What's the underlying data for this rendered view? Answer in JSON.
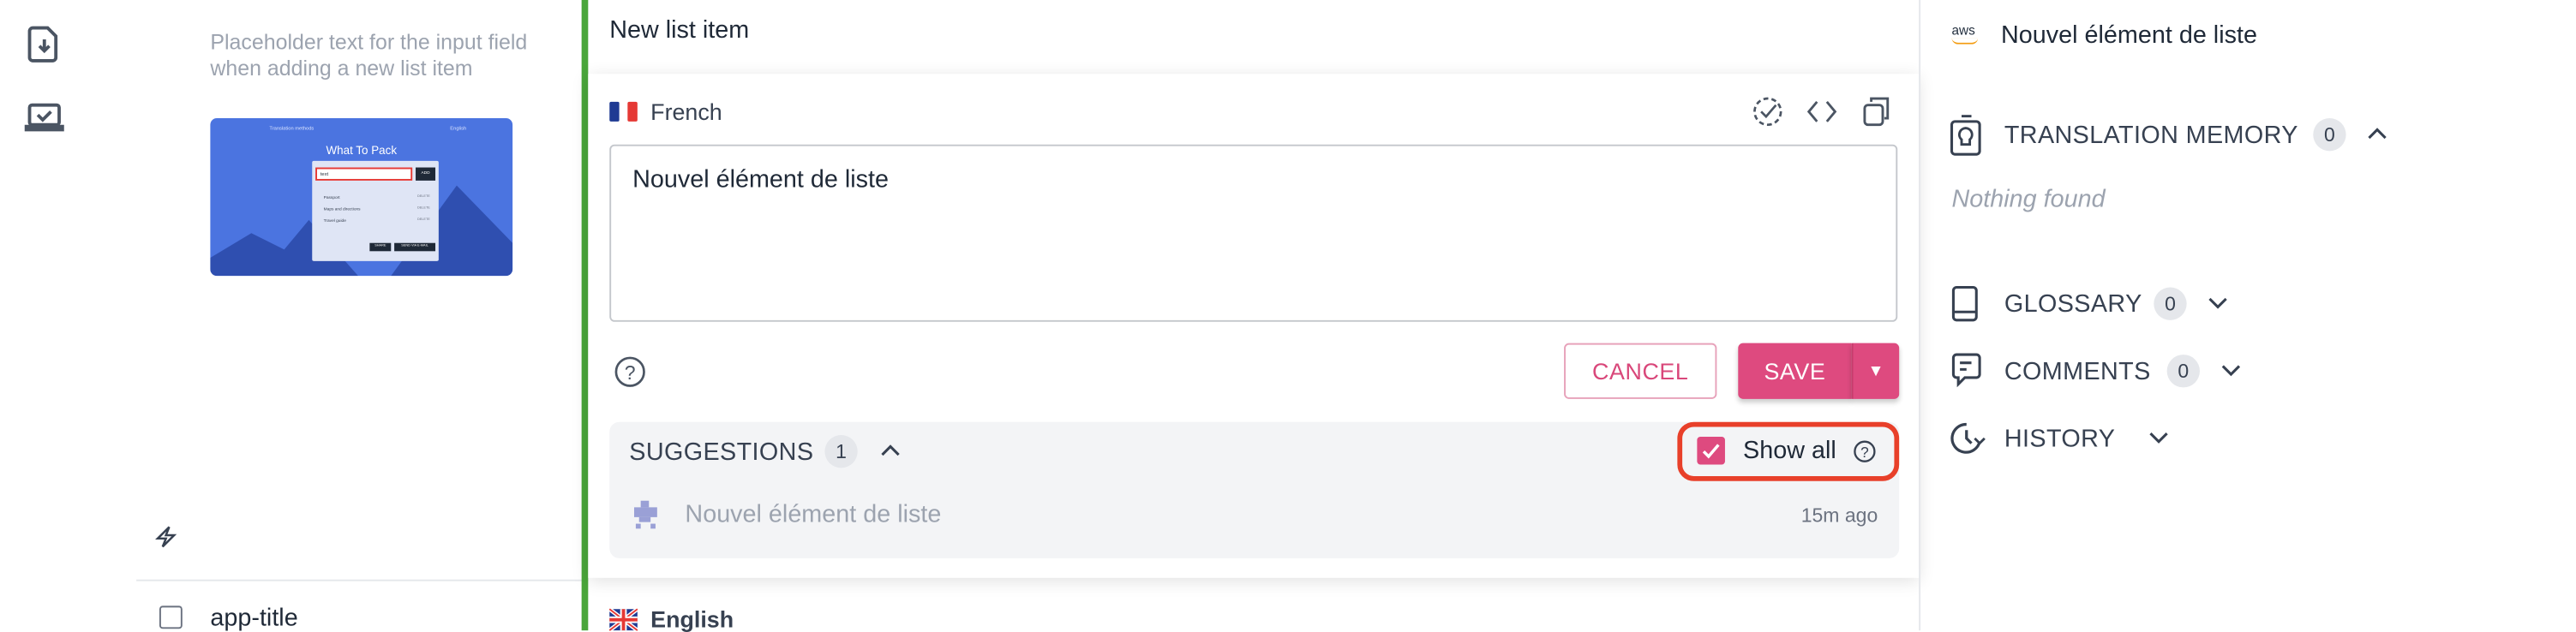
{
  "left": {
    "placeholder_text": "Placeholder text for the input field when adding a new list item",
    "screenshot": {
      "title": "What To Pack",
      "input_value": "text",
      "add_label": "ADD",
      "items": [
        "Passport",
        "Maps and directions",
        "Travel guide"
      ],
      "delete_label": "DELETE",
      "share_label": "SHARE",
      "email_label": "SEND VIA E-MAIL",
      "top_left": "Translation methods",
      "top_right": "English"
    },
    "next_key": "app-title"
  },
  "editor": {
    "source_text": "New list item",
    "language": "French",
    "translation_value": "Nouvel élément de liste",
    "cancel_label": "CANCEL",
    "save_label": "SAVE",
    "suggestions": {
      "title": "SUGGESTIONS",
      "count": "1",
      "show_all_label": "Show all",
      "show_all_checked": true,
      "items": [
        {
          "text": "Nouvel élément de liste",
          "time": "15m ago"
        }
      ]
    },
    "next_language": "English"
  },
  "right": {
    "machine_translation": {
      "provider": "aws",
      "text": "Nouvel élément de liste"
    },
    "translation_memory": {
      "title": "TRANSLATION MEMORY",
      "count": "0",
      "empty": "Nothing found"
    },
    "glossary": {
      "title": "GLOSSARY",
      "count": "0"
    },
    "comments": {
      "title": "COMMENTS",
      "count": "0"
    },
    "history": {
      "title": "HISTORY"
    }
  },
  "colors": {
    "accent": "#de4a7f",
    "green": "#4aa63b",
    "highlight": "#e8402a"
  }
}
